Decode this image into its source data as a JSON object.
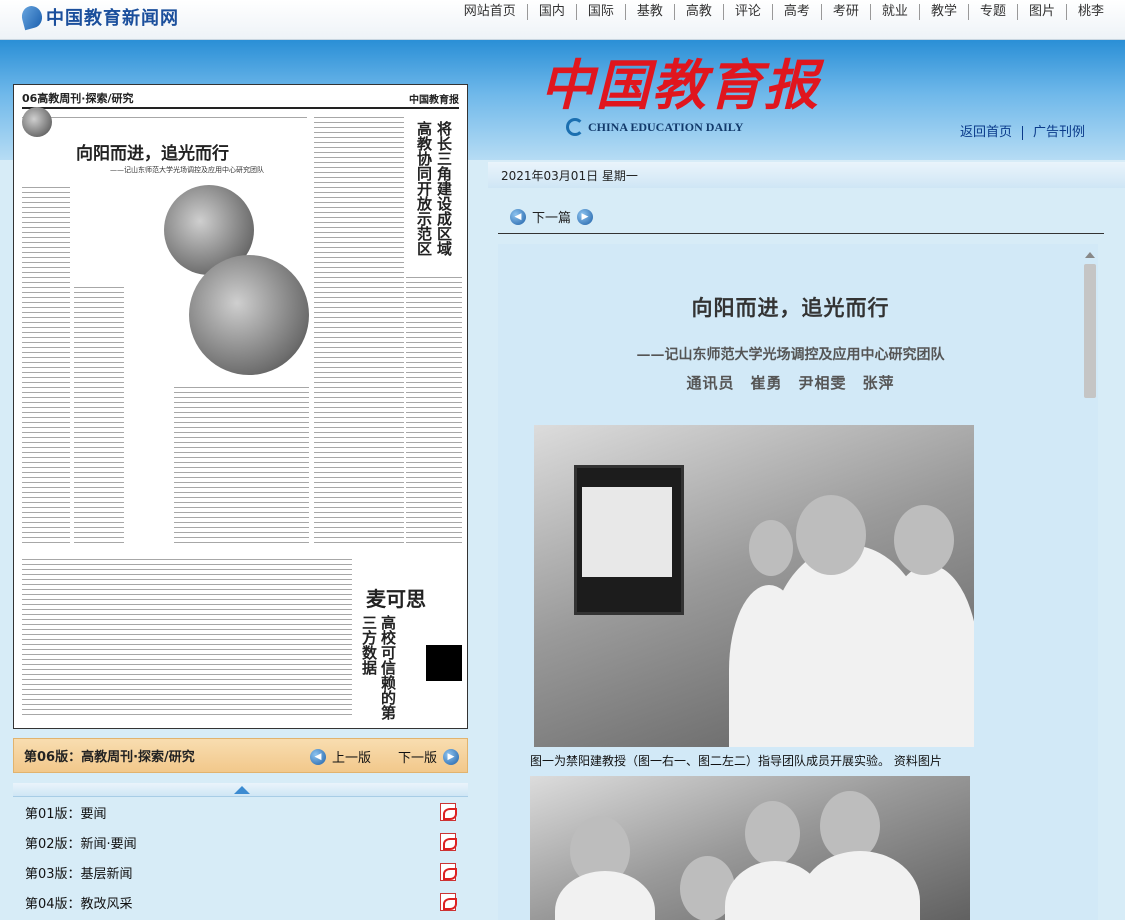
{
  "site": {
    "logo_text": "中国教育新闻网",
    "nav": [
      "网站首页",
      "国内",
      "国际",
      "基教",
      "高教",
      "评论",
      "高考",
      "考研",
      "就业",
      "教学",
      "专题",
      "图片",
      "桃李"
    ]
  },
  "masthead": {
    "title_cn": "中国教育报",
    "title_en": "CHINA EDUCATION DAILY",
    "links": [
      "返回首页",
      "广告刊例"
    ]
  },
  "date": "2021年03月01日 星期一",
  "newspaper_page": {
    "page_label": "06高教周刊·探索/研究",
    "brand": "中国教育报",
    "headline": "向阳而进，追光而行",
    "subhead": "——记山东师范大学光场调控及应用中心研究团队",
    "side_headline": "将长三角建设成区域高教协同开放示范区",
    "ad_title": "麦可思",
    "ad_vertical": "高校可信赖的第三方数据"
  },
  "page_nav": {
    "current": "第06版：高教周刊·探索/研究",
    "prev_label": "上一版",
    "next_label": "下一版"
  },
  "editions": [
    {
      "label": "第01版：要闻"
    },
    {
      "label": "第02版：新闻·要闻"
    },
    {
      "label": "第03版：基层新闻"
    },
    {
      "label": "第04版：教改风采"
    }
  ],
  "article": {
    "next_article_label": "下一篇",
    "title": "向阳而进，追光而行",
    "subtitle": "——记山东师范大学光场调控及应用中心研究团队",
    "author": "通讯员　崔勇　尹相雯　张萍",
    "caption": "图一为禁阳建教授（图一右一、图二左二）指导团队成员开展实验。 资料图片"
  },
  "colors": {
    "header_blue": "#2a8fd6",
    "masthead_red": "#e0161e",
    "page_bar_orange": "#f2c88b",
    "panel_bg": "#d2e9f7"
  }
}
